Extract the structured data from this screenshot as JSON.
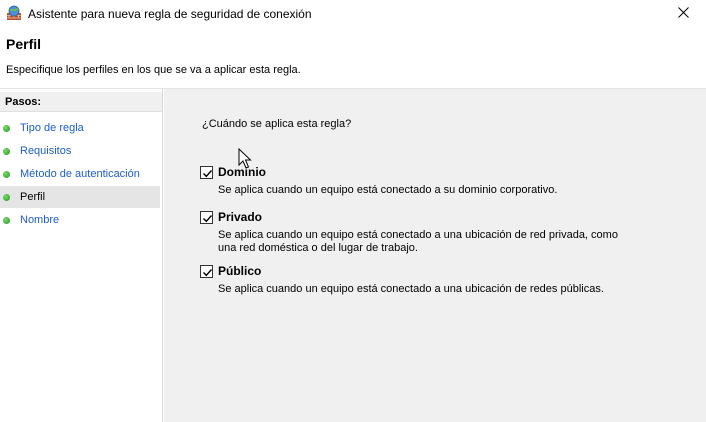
{
  "window": {
    "title": "Asistente para nueva regla de seguridad de conexión",
    "close_symbol": "✕"
  },
  "header": {
    "title": "Perfil",
    "description": "Especifique los perfiles en los que se va a aplicar esta regla."
  },
  "sidebar": {
    "title": "Pasos:",
    "steps": [
      {
        "label": "Tipo de regla"
      },
      {
        "label": "Requisitos"
      },
      {
        "label": "Método de autenticación"
      },
      {
        "label": "Perfil"
      },
      {
        "label": "Nombre"
      }
    ],
    "active_step": "Perfil"
  },
  "main": {
    "question": "¿Cuándo se aplica esta regla?",
    "options": [
      {
        "label": "Dominio",
        "checked": true,
        "description": "Se aplica cuando un equipo está conectado a su dominio corporativo."
      },
      {
        "label": "Privado",
        "checked": true,
        "description": "Se aplica cuando un equipo está conectado a una ubicación de red privada, como una red doméstica o del lugar de trabajo."
      },
      {
        "label": "Público",
        "checked": true,
        "description": "Se aplica cuando un equipo está conectado a una ubicación de redes públicas."
      }
    ]
  },
  "colors": {
    "link": "#1d5ec9",
    "panel_bg": "#f0f0f0",
    "step_dot": "#2ea82a"
  },
  "icons": {
    "app": "firewall-globe-icon",
    "close": "close-icon",
    "step": "green-dot-icon",
    "check": "checkmark-icon"
  }
}
